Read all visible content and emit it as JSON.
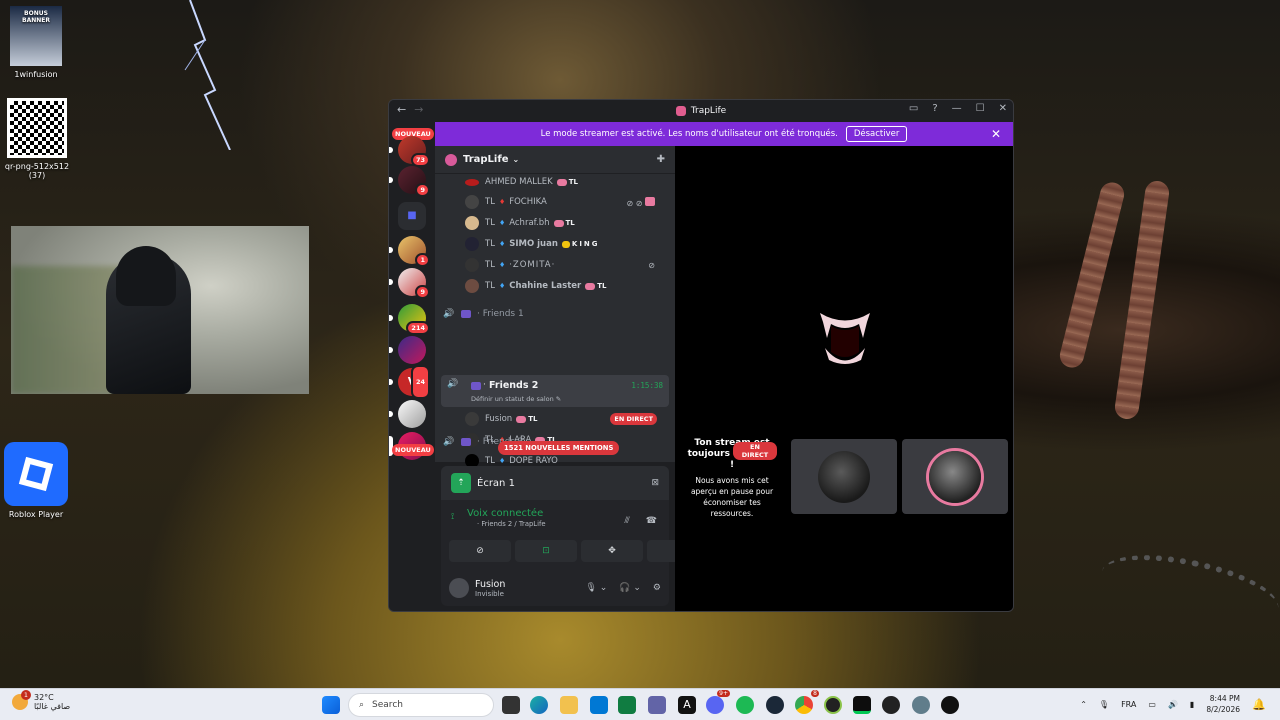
{
  "desktop": {
    "icons": [
      {
        "label": "1winfusion",
        "banner_text": "BONUS BANNER"
      },
      {
        "label": "qr-png-512x512\n(37)"
      },
      {
        "label": "Roblox Player"
      }
    ]
  },
  "window": {
    "title": "TrapLife",
    "back_icon": "arrow-left-icon",
    "forward_icon": "arrow-right-icon"
  },
  "banner": {
    "text": "Le mode streamer est activé. Les noms d'utilisateur ont été tronqués.",
    "button": "Désactiver"
  },
  "guilds": {
    "new_label": "NOUVEAU",
    "badges": [
      "73",
      "9",
      "1",
      "9",
      "214",
      "24"
    ],
    "new_label_bottom": "NOUVEAU"
  },
  "server": {
    "name": "TrapLife"
  },
  "voice_users_top": [
    {
      "name": "AHMED MALLEK",
      "prefix": "",
      "tag": "TL"
    },
    {
      "name": "FOCHIKA",
      "prefix": "TL",
      "tag": ""
    },
    {
      "name": "Achraf.bh",
      "prefix": "TL",
      "tag": "TL"
    },
    {
      "name": "SIMO juan",
      "prefix": "TL",
      "tag": "KING"
    },
    {
      "name": "·ZOMITA·",
      "prefix": "TL",
      "tag": ""
    },
    {
      "name": "Chahine Laster",
      "prefix": "TL",
      "tag": "TL"
    }
  ],
  "channels": {
    "friends1": "Friends 1",
    "friends2": "Friends 2",
    "friends2_status": "Définir un statut de salon",
    "friends2_time": "1:15:38",
    "friends3": "Friends 3"
  },
  "voice_users_f2": [
    {
      "name": "Fusion",
      "prefix": "",
      "tag": "TL",
      "live": "EN DIRECT"
    },
    {
      "name": "LARA",
      "prefix": "TL",
      "tag": "TL"
    },
    {
      "name": "DOPE RAYO",
      "prefix": "TL",
      "tag": ""
    }
  ],
  "mentions": "1521 NOUVELLES MENTIONS",
  "panel": {
    "screen_title": "Écran 1",
    "voice_connected": "Voix connectée",
    "voice_location": "Friends 2 / TrapLife",
    "username": "Fusion",
    "user_status": "Invisible"
  },
  "stage": {
    "live_badge": "EN DIRECT",
    "paused_title": "Ton stream est toujours en cours !",
    "paused_body": "Nous avons mis cet aperçu en pause pour économiser tes ressources."
  },
  "taskbar": {
    "temperature": "32°C",
    "weather_text": "صافي غالبًا",
    "weather_badge": "1",
    "search_placeholder": "Search",
    "language": "FRA",
    "time": "8:44 PM",
    "date": "8/2/2026",
    "app_badges": [
      "9+",
      "8"
    ]
  }
}
